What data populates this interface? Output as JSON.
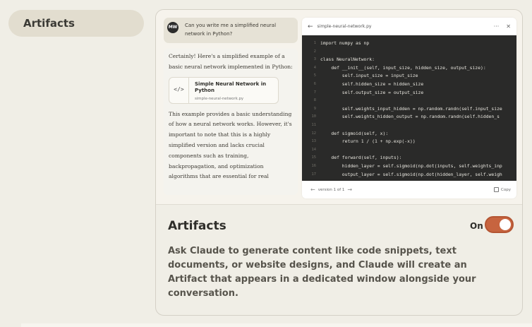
{
  "sidebar": {
    "active_item": "Artifacts"
  },
  "preview": {
    "user_avatar": "MW",
    "user_message": "Can you write me a simplified neural network in Python?",
    "assistant_intro": "Certainly! Here's a simplified example of a basic neural network implemented in Python:",
    "artifact": {
      "icon": "code-icon",
      "title": "Simple Neural Network in Python",
      "filename": "simple-neural-network.py"
    },
    "assistant_body": "This example provides a basic understanding of how a neural network works. However, it's important to note that this is a highly simplified version and lacks crucial components such as training, backpropagation, and optimization algorithms that are essential for real",
    "code_panel": {
      "filename": "simple-neural-network.py",
      "version_label": "version 1 of 1",
      "copy_label": "Copy",
      "lines": [
        {
          "n": "1",
          "code": "import numpy as np"
        },
        {
          "n": "2",
          "code": ""
        },
        {
          "n": "3",
          "code": "class NeuralNetwork:"
        },
        {
          "n": "4",
          "code": "    def __init__(self, input_size, hidden_size, output_size):"
        },
        {
          "n": "5",
          "code": "        self.input_size = input_size"
        },
        {
          "n": "6",
          "code": "        self.hidden_size = hidden_size"
        },
        {
          "n": "7",
          "code": "        self.output_size = output_size"
        },
        {
          "n": "8",
          "code": ""
        },
        {
          "n": "9",
          "code": "        self.weights_input_hidden = np.random.randn(self.input_size"
        },
        {
          "n": "10",
          "code": "        self.weights_hidden_output = np.random.randn(self.hidden_s"
        },
        {
          "n": "11",
          "code": ""
        },
        {
          "n": "12",
          "code": "    def sigmoid(self, x):"
        },
        {
          "n": "13",
          "code": "        return 1 / (1 + np.exp(-x))"
        },
        {
          "n": "14",
          "code": ""
        },
        {
          "n": "15",
          "code": "    def forward(self, inputs):"
        },
        {
          "n": "16",
          "code": "        hidden_layer = self.sigmoid(np.dot(inputs, self.weights_inp"
        },
        {
          "n": "17",
          "code": "        output_layer = self.sigmoid(np.dot(hidden_layer, self.weigh"
        }
      ]
    }
  },
  "setting": {
    "title": "Artifacts",
    "toggle_label": "On",
    "toggle_on": true,
    "description": "Ask Claude to generate content like code snippets, text documents, or website designs, and Claude will create an Artifact that appears in a dedicated window alongside your conversation."
  },
  "colors": {
    "toggle_accent": "#c7643f",
    "code_bg": "#2a2a29",
    "page_bg": "#f0eee6"
  }
}
